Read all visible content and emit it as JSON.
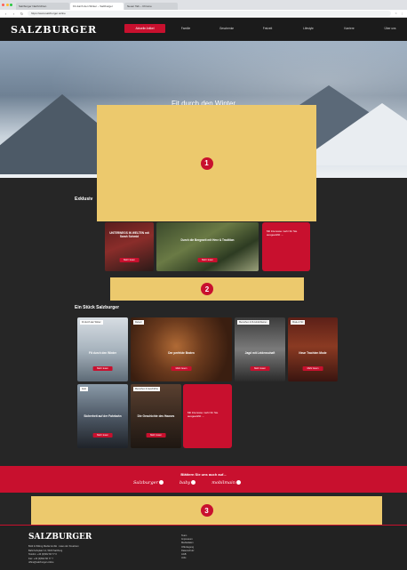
{
  "browser": {
    "tabs": [
      "Salzburger Nachrichten",
      "Fit durch den Winter – Salzburger",
      "Neuer Tab – Chrome"
    ],
    "address": "https://www.salzburger.online",
    "traffic_colors": [
      "#ff5f57",
      "#febc2e",
      "#28c840"
    ]
  },
  "header": {
    "logo": "SALZBURGER",
    "nav": [
      "Aktuelle Artikel",
      "Familie",
      "Geschenke",
      "Freizeit",
      "Lifestyle",
      "Karriere",
      "Über uns"
    ]
  },
  "hero": {
    "title": "Fit durch den Winter"
  },
  "placeholders": {
    "one": "1",
    "two": "2",
    "three": "3"
  },
  "exclusive": {
    "title": "Exklusiv",
    "cards": [
      {
        "caption": "UNTERWEGS IN WELTEN mit Sarah Schmid",
        "button": "Mehr lesen"
      },
      {
        "caption": "Durch die Bergwelt mit Herz & Tradition",
        "button": "Mehr lesen"
      }
    ],
    "promo": {
      "text": "Mit Interesse mehr für Sie ausgewählt →"
    }
  },
  "stueck": {
    "title": "Ein Stück Salzburger",
    "cards": [
      {
        "tag": "Fit durch den Winter",
        "caption": "Fit durch den Winter",
        "button": "Mehr lesen"
      },
      {
        "tag": "Rezept",
        "caption": "Der perfekte Braten",
        "button": "Mehr lesen"
      },
      {
        "tag": "Menschen & Persönlichkeiten",
        "caption": "Jagd mit Leidenschaft",
        "button": "Mehr lesen"
      },
      {
        "tag": "Mode & Stil",
        "caption": "Neue Trachten Mode",
        "button": "Mehr lesen"
      },
      {
        "tag": "Auto",
        "caption": "Sicherheit auf der Fahrbahn",
        "button": "Mehr lesen"
      },
      {
        "tag": "Menschen & Geschichte",
        "caption": "Die Geschichte des Hauses",
        "button": "Mehr lesen"
      }
    ],
    "promo": {
      "text": "Mit Interesse mehr für Sie ausgewählt →"
    }
  },
  "band": {
    "heading": "Blättern Sie uns auch auf...",
    "magazines": [
      "Salzburger",
      "baby",
      "mobilmain"
    ]
  },
  "footer": {
    "logo": "SALZBURGER",
    "address": [
      "Bold & Wiking Media GmbH · Haus der Kreativen",
      "Bahnhofsplatz 12, 5020 Salzburg",
      "Telefon: +43 (0)662 66 77 0",
      "Fax: +43 (0)662 66 77 7",
      "office@salzburger.online"
    ],
    "links": [
      "Team",
      "Impressum",
      "Mediadaten",
      "Offenlegung",
      "Datenschutz",
      "AGB",
      "Jobs"
    ]
  }
}
